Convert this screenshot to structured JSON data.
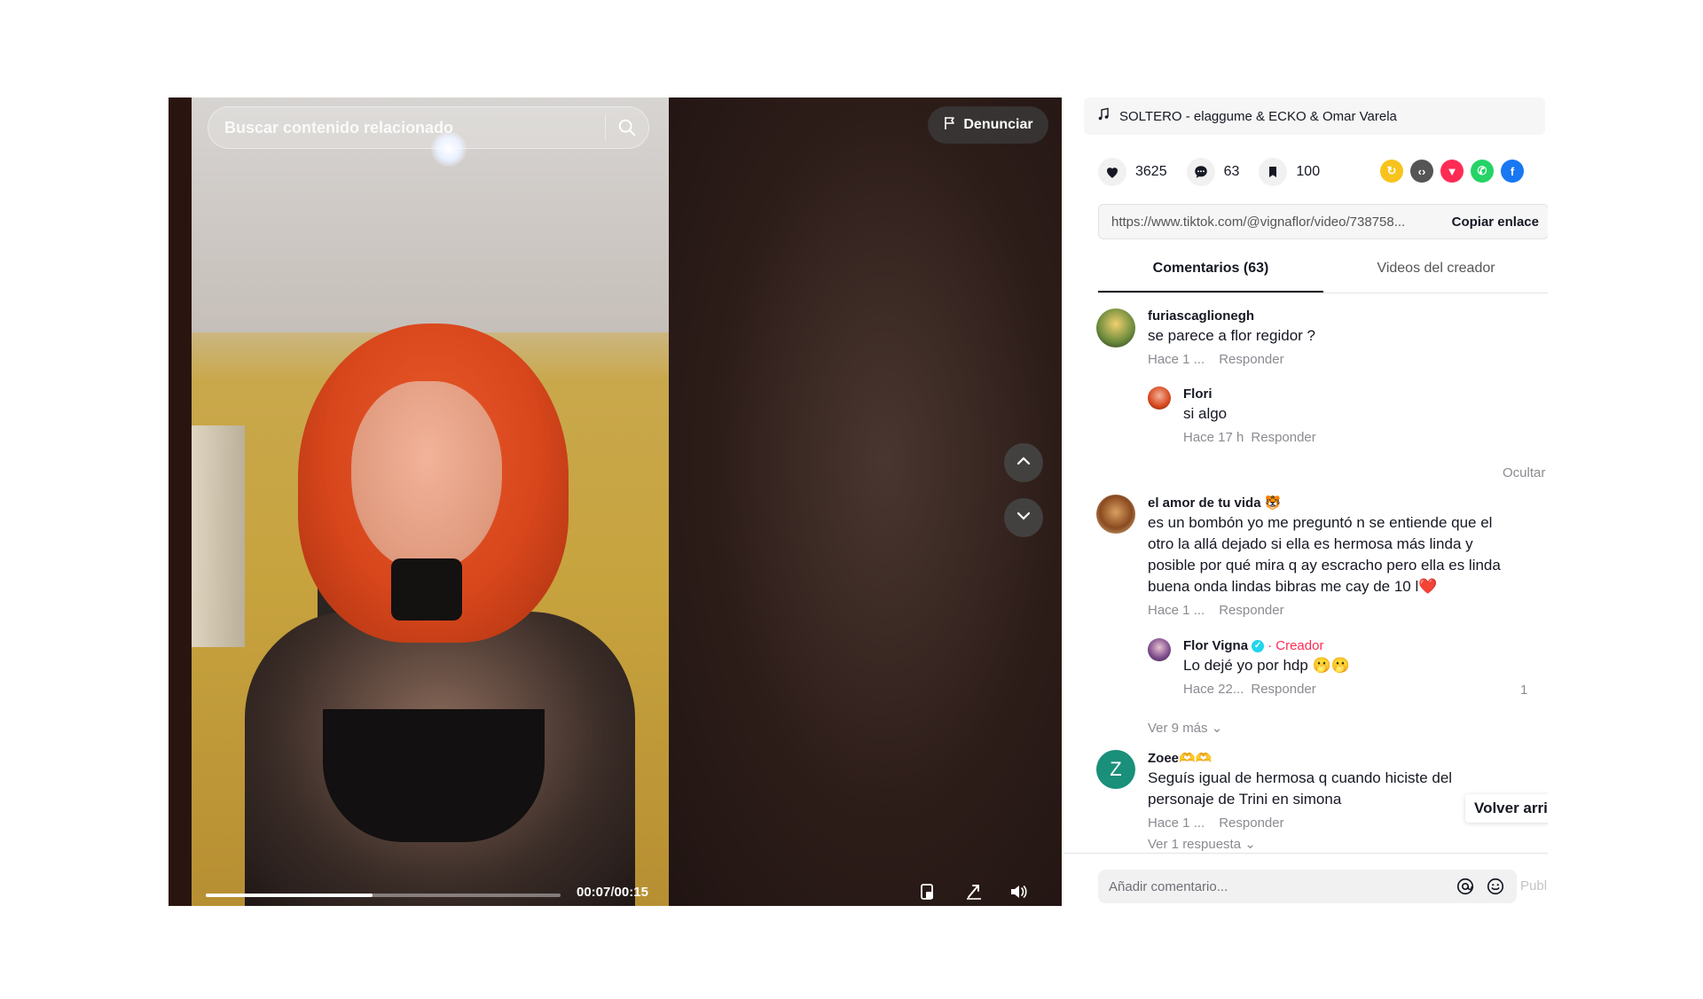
{
  "video": {
    "search_placeholder": "Buscar contenido relacionado",
    "report_label": "Denunciar",
    "time_current": "00:07",
    "time_total": "00:15",
    "time_separator": "/",
    "progress_fraction": 0.47
  },
  "panel": {
    "music": "SOLTERO - elaggume & ECKO & Omar Varela",
    "stats": {
      "likes": "3625",
      "comments": "63",
      "saves": "100"
    },
    "link": "https://www.tiktok.com/@vignaflor/video/738758...",
    "copy_label": "Copiar enlace",
    "tabs": [
      "Comentarios (63)",
      "Videos del creador"
    ],
    "comments": [
      {
        "user": "furiascaglionegh",
        "text": "se parece a flor regidor ?",
        "time": "Hace 1 ...",
        "reply_label": "Responder",
        "replies": [
          {
            "user": "Flori",
            "text": "si algo",
            "time": "Hace 17 h",
            "reply_label": "Responder"
          }
        ]
      },
      {
        "user": "el amor de tu vida 🐯",
        "text": "es un bombón yo me preguntó n se entiende que el otro la allá dejado si ella es hermosa más linda y posible por qué mira q ay escracho pero ella es linda buena onda lindas bibras me cay de 10 l❤️",
        "time": "Hace 1 ...",
        "reply_label": "Responder",
        "replies": [
          {
            "user": "Flor Vigna",
            "creator_tag": "· Creador",
            "text": "Lo dejé yo por hdp 🫢🫢",
            "time": "Hace 22...",
            "reply_label": "Responder",
            "likes": "1"
          }
        ]
      },
      {
        "user": "Zoee🫶🫶",
        "avatar_letter": "Z",
        "text": "Seguís igual de hermosa q cuando hiciste del personaje de Trini en simona",
        "time": "Hace 1 ...",
        "reply_label": "Responder",
        "more_replies": "Ver 1 respuesta"
      }
    ],
    "hide_label": "Ocultar",
    "see_more": "Ver 9 más",
    "back_to_top": "Volver arrib",
    "comment_placeholder": "Añadir comentario...",
    "post_label": "Publ"
  },
  "colors": {
    "accent": "#fe2c55",
    "verified": "#20d5ec"
  }
}
